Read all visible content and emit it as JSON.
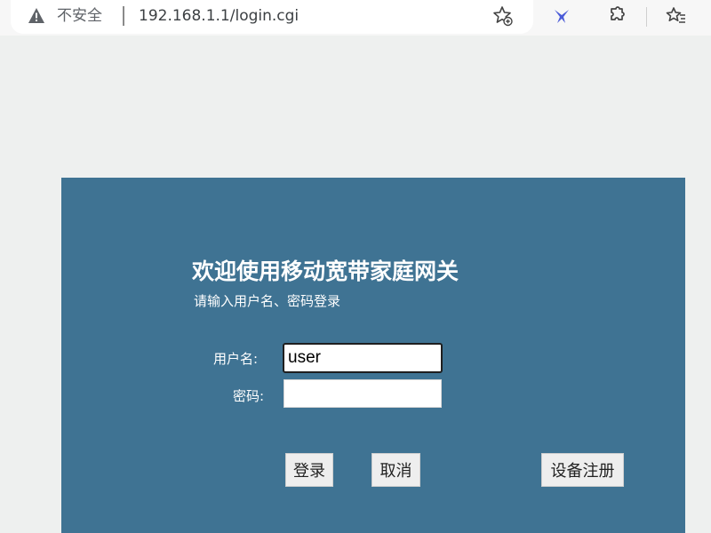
{
  "browser": {
    "security_label": "不安全",
    "url": "192.168.1.1/login.cgi",
    "icons": [
      "warning-icon",
      "star-add-icon",
      "assistant-icon",
      "extensions-icon",
      "favorites-icon"
    ]
  },
  "login": {
    "title": "欢迎使用移动宽带家庭网关",
    "subtitle": "请输入用户名、密码登录",
    "username_label": "用户名:",
    "username_value": "user",
    "password_label": "密码:",
    "password_value": "",
    "login_button": "登录",
    "cancel_button": "取消",
    "register_button": "设备注册"
  },
  "colors": {
    "panel": "#3f7393",
    "page_background": "#eef0ef"
  }
}
